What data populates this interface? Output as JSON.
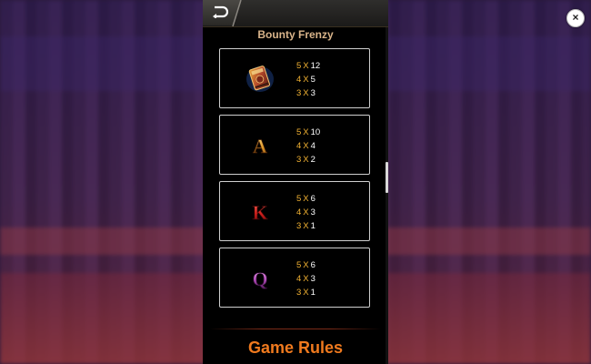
{
  "game": {
    "title": "Bounty Frenzy"
  },
  "close_label": "×",
  "paytable": [
    {
      "symbol": "book-icon",
      "payouts": [
        {
          "count": "5",
          "x": "X",
          "value": "12"
        },
        {
          "count": "4",
          "x": "X",
          "value": "5"
        },
        {
          "count": "3",
          "x": "X",
          "value": "3"
        }
      ]
    },
    {
      "symbol": "letter-a-icon",
      "letter": "A",
      "payouts": [
        {
          "count": "5",
          "x": "X",
          "value": "10"
        },
        {
          "count": "4",
          "x": "X",
          "value": "4"
        },
        {
          "count": "3",
          "x": "X",
          "value": "2"
        }
      ]
    },
    {
      "symbol": "letter-k-icon",
      "letter": "K",
      "payouts": [
        {
          "count": "5",
          "x": "X",
          "value": "6"
        },
        {
          "count": "4",
          "x": "X",
          "value": "3"
        },
        {
          "count": "3",
          "x": "X",
          "value": "1"
        }
      ]
    },
    {
      "symbol": "letter-q-icon",
      "letter": "Q",
      "payouts": [
        {
          "count": "5",
          "x": "X",
          "value": "6"
        },
        {
          "count": "4",
          "x": "X",
          "value": "3"
        },
        {
          "count": "3",
          "x": "X",
          "value": "1"
        }
      ]
    }
  ],
  "rules": {
    "title": "Game Rules"
  },
  "colors": {
    "accent": "#f07a1e",
    "count": "#f2b233",
    "title": "#d9b48a",
    "card_border": "#cfcfcf"
  }
}
